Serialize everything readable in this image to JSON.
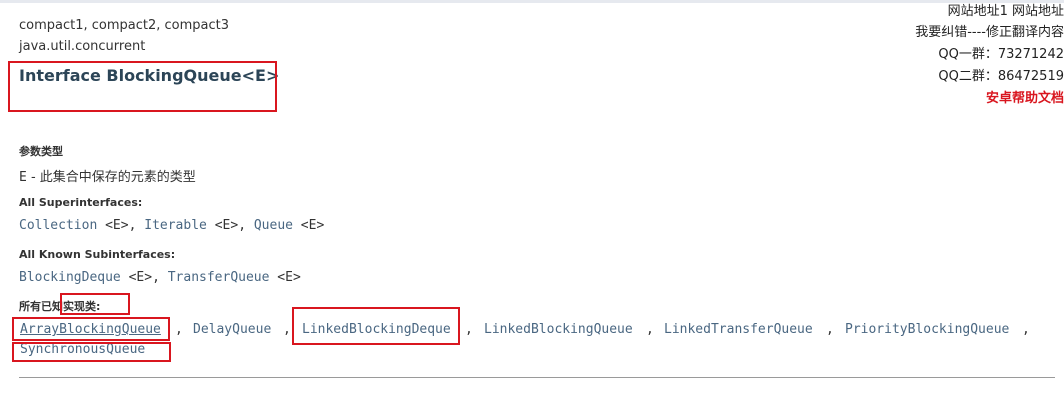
{
  "header": {
    "profiles": "compact1, compact2, compact3",
    "package": "java.util.concurrent",
    "title": "Interface BlockingQueue<E>"
  },
  "right_panel": {
    "line1": "网站地址1 网站地址",
    "line2": "我要纠错----修正翻译内容",
    "line3": "QQ一群：73271242",
    "line4": "QQ二群：86472519",
    "line5": "安卓帮助文档"
  },
  "type_params": {
    "heading": "参数类型",
    "param_name": "E",
    "param_desc": " - 此集合中保存的元素的类型"
  },
  "superinterfaces": {
    "heading": "All Superinterfaces:",
    "items": [
      {
        "name": "Collection",
        "generic": " <E>"
      },
      {
        "name": "Iterable",
        "generic": " <E>"
      },
      {
        "name": "Queue",
        "generic": " <E>"
      }
    ]
  },
  "subinterfaces": {
    "heading": "All Known Subinterfaces:",
    "items": [
      {
        "name": "BlockingDeque",
        "generic": " <E>"
      },
      {
        "name": "TransferQueue",
        "generic": " <E>"
      }
    ]
  },
  "implementing": {
    "heading": "所有已知实现类:",
    "row1": [
      "ArrayBlockingQueue",
      "DelayQueue",
      "LinkedBlockingDeque",
      "LinkedBlockingQueue",
      "LinkedTransferQueue",
      "PriorityBlockingQueue"
    ],
    "row2": [
      "SynchronousQueue"
    ]
  },
  "separators": {
    "comma": ","
  },
  "colors": {
    "link": "#4a6782",
    "title": "#2c4557",
    "highlight_box": "#d9161f"
  }
}
